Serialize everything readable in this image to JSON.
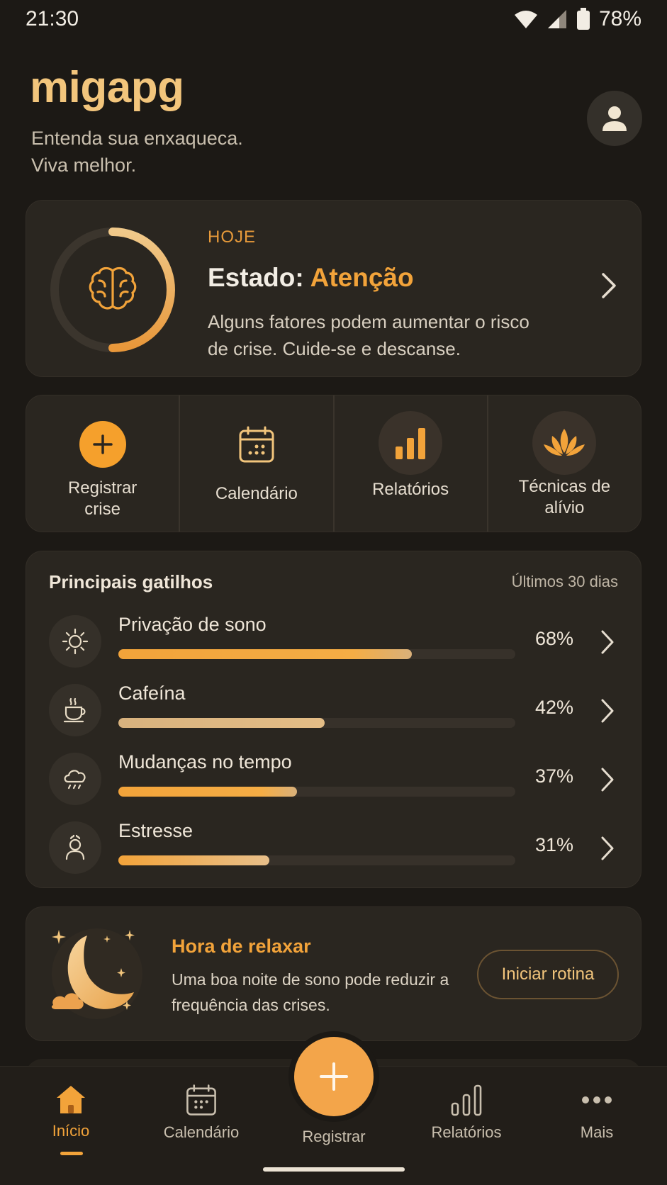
{
  "status_bar": {
    "time": "21:30",
    "battery": "78%"
  },
  "header": {
    "app_name": "migapg",
    "tagline_line1": "Entenda sua enxaqueca.",
    "tagline_line2": "Viva melhor."
  },
  "status_card": {
    "label": "HOJE",
    "state_prefix": "Estado: ",
    "state_value": "Atenção",
    "description": "Alguns fatores podem aumentar o risco de crise. Cuide-se e descanse.",
    "icon": "brain-icon"
  },
  "quick_actions": [
    {
      "label": "Registrar crise",
      "icon": "plus-icon"
    },
    {
      "label": "Calendário",
      "icon": "calendar-icon"
    },
    {
      "label": "Relatórios",
      "icon": "bar-chart-icon"
    },
    {
      "label": "Técnicas de alívio",
      "icon": "lotus-icon"
    }
  ],
  "triggers": {
    "title": "Principais gatilhos",
    "period": "Últimos 30 dias",
    "items": [
      {
        "label": "Privação de sono",
        "percent": "68%",
        "value": 0.74,
        "icon": "sun-icon"
      },
      {
        "label": "Cafeína",
        "percent": "42%",
        "value": 0.52,
        "icon": "coffee-icon"
      },
      {
        "label": "Mudanças no tempo",
        "percent": "37%",
        "value": 0.45,
        "icon": "cloud-rain-icon"
      },
      {
        "label": "Estresse",
        "percent": "31%",
        "value": 0.38,
        "icon": "stress-person-icon"
      }
    ]
  },
  "relax": {
    "title": "Hora de relaxar",
    "description": "Uma boa noite de sono pode reduzir a frequência das crises.",
    "button": "Iniciar rotina",
    "icon": "moon-icon"
  },
  "bottom_nav": {
    "items": [
      {
        "label": "Início",
        "icon": "home-icon",
        "active": true
      },
      {
        "label": "Calendário",
        "icon": "calendar-icon"
      },
      {
        "label": "Registrar",
        "icon": "plus-icon"
      },
      {
        "label": "Relatórios",
        "icon": "bar-chart-icon"
      },
      {
        "label": "Mais",
        "icon": "more-icon"
      }
    ]
  },
  "colors": {
    "accent": "#f2a33a",
    "background": "#1c1915",
    "card": "#2a2620"
  }
}
